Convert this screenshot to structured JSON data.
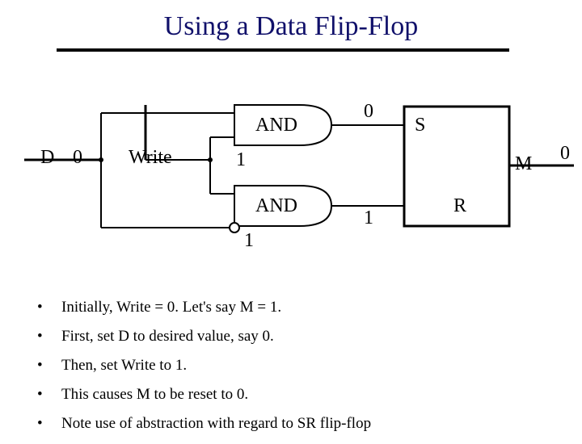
{
  "title": "Using a Data Flip-Flop",
  "diagram": {
    "D": "D",
    "D_val": "0",
    "Write": "Write",
    "AND_top": "AND",
    "AND_top_out": "0",
    "AND_bot": "AND",
    "AND_bot_out": "1",
    "inv_out": "1",
    "mid_write": "1",
    "S": "S",
    "R": "R",
    "M": "M",
    "M_val": "0"
  },
  "bullets": [
    "Initially,  Write = 0.   Let's say M = 1.",
    "First, set D to desired value, say 0.",
    "Then, set Write to 1.",
    "This causes M to be reset to 0.",
    "Note use of abstraction with regard to SR flip-flop"
  ]
}
